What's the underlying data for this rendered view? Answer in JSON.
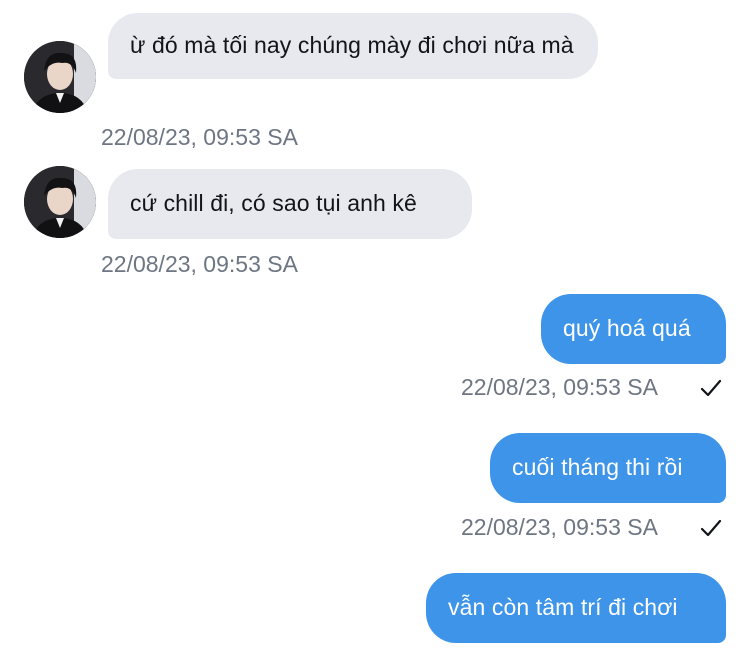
{
  "messages": [
    {
      "direction": "incoming",
      "text": "ừ đó mà tối nay chúng mày đi chơi nữa mà",
      "time": "22/08/23, 09:53 SA"
    },
    {
      "direction": "incoming",
      "text": "cứ chill đi, có sao tụi anh kê",
      "time": "22/08/23, 09:53 SA"
    },
    {
      "direction": "outgoing",
      "text": "quý hoá quá",
      "time": "22/08/23, 09:53 SA",
      "status_icon": "checkmark-icon"
    },
    {
      "direction": "outgoing",
      "text": "cuối tháng thi rồi",
      "time": "22/08/23, 09:53 SA",
      "status_icon": "checkmark-icon"
    },
    {
      "direction": "outgoing",
      "text": "vẫn còn tâm trí đi chơi",
      "time": "",
      "status_icon": ""
    }
  ],
  "colors": {
    "incoming_bubble": "#e7e9ee",
    "outgoing_bubble": "#3d94e8",
    "timestamp": "#6e7683"
  }
}
